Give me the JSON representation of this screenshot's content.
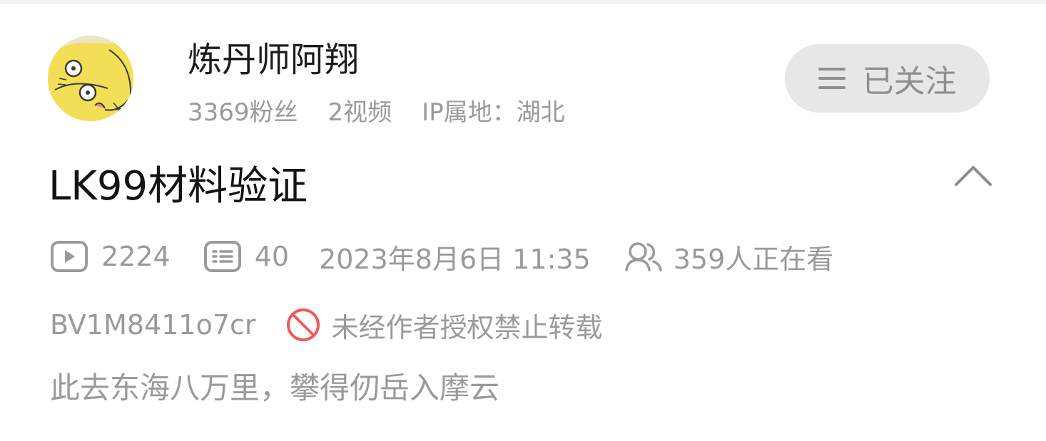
{
  "uploader": {
    "name": "炼丹师阿翔",
    "followers": "3369粉丝",
    "videos": "2视频",
    "ip_location": "IP属地：湖北"
  },
  "follow_button": {
    "label": "已关注",
    "icon": "menu-icon"
  },
  "video": {
    "title": "LK99材料验证",
    "plays": "2224",
    "danmaku": "40",
    "publish_time": "2023年8月6日 11:35",
    "watching_now": "359人正在看",
    "bvid": "BV1M8411o7cr",
    "copyright_notice": "未经作者授权禁止转载",
    "description": "此去东海八万里，攀得仞岳入摩云"
  },
  "icons": {
    "play": "play-count-icon",
    "danmaku": "danmaku-count-icon",
    "viewers": "viewers-icon",
    "no_repost": "no-repost-icon",
    "collapse": "chevron-up-icon"
  },
  "colors": {
    "title": "#141414",
    "secondary_text": "#9a9a9a",
    "follow_button_bg": "#e7e7e7",
    "warning_red": "#f15a5a",
    "avatar_yellow": "#f2df55"
  }
}
